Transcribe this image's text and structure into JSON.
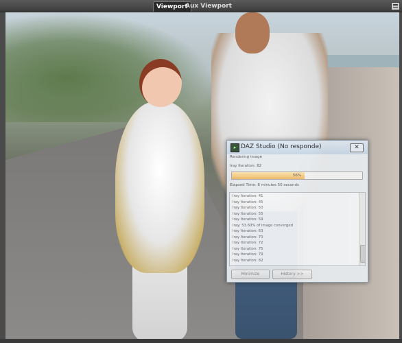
{
  "tabs": [
    {
      "label": "Viewport",
      "active": true
    },
    {
      "label": "Aux Viewport",
      "active": false
    }
  ],
  "tab_menu_icon": "panel-menu-icon",
  "dialog": {
    "title": "DAZ Studio (No responde)",
    "app_icon": "daz-studio-icon",
    "close_icon": "close-icon",
    "rendering_label": "Rendering image",
    "iteration_label": "Iray Iteration: 82",
    "progress": {
      "percent_text": "56%",
      "fraction": 0.56,
      "fill_color": "#f1b865"
    },
    "elapsed": "Elapsed Time:  8 minutes 50 seconds",
    "history": [
      "Iray Iteration: 41",
      "Iray Iteration: 45",
      "Iray Iteration: 50",
      "Iray Iteration: 55",
      "Iray Iteration: 59",
      "Iray: 53.60% of image converged",
      "Iray Iteration: 63",
      "Iray Iteration: 70",
      "Iray Iteration: 72",
      "Iray Iteration: 75",
      "Iray Iteration: 79",
      "Iray Iteration: 82"
    ],
    "buttons": {
      "minimize": "Minimize",
      "history": "History >>"
    }
  }
}
